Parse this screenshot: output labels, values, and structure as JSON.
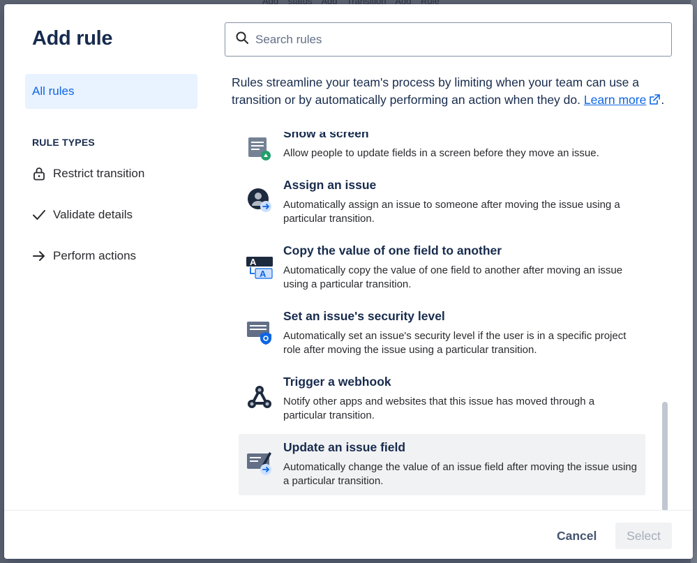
{
  "background": {
    "tabs_text": "Add status   Add Transition   Add Rule"
  },
  "modal": {
    "title": "Add rule",
    "sidebar": {
      "all_rules_label": "All rules",
      "rule_types_heading": "RULE TYPES",
      "types": [
        {
          "label": "Restrict transition",
          "icon": "lock-icon"
        },
        {
          "label": "Validate details",
          "icon": "check-icon"
        },
        {
          "label": "Perform actions",
          "icon": "arrow-right-icon"
        }
      ]
    },
    "search": {
      "placeholder": "Search rules",
      "value": ""
    },
    "description": {
      "text": "Rules streamline your team's process by limiting when your team can use a transition or by automatically performing an action when they do. ",
      "link_text": "Learn more",
      "trailing": "."
    },
    "rules": [
      {
        "title": "Show a screen",
        "text": "Allow people to update fields in a screen before they move an issue.",
        "icon": "screen-icon"
      },
      {
        "title": "Assign an issue",
        "text": "Automatically assign an issue to someone after moving the issue using a particular transition.",
        "icon": "assign-user-icon"
      },
      {
        "title": "Copy the value of one field to another",
        "text": "Automatically copy the value of one field to another after moving an issue using a particular transition.",
        "icon": "copy-field-icon"
      },
      {
        "title": "Set an issue's security level",
        "text": "Automatically set an issue's security level if the user is in a specific project role after moving the issue using a particular transition.",
        "icon": "security-level-icon"
      },
      {
        "title": "Trigger a webhook",
        "text": "Notify other apps and websites that this issue has moved through a particular transition.",
        "icon": "webhook-icon"
      },
      {
        "title": "Update an issue field",
        "text": "Automatically change the value of an issue field after moving the issue using a particular transition.",
        "icon": "update-field-icon"
      }
    ],
    "footer": {
      "cancel_label": "Cancel",
      "select_label": "Select"
    }
  },
  "colors": {
    "accent": "#0c66e4",
    "selected_nav_bg": "#e9f2ff",
    "hover_row_bg": "#f1f2f4"
  }
}
